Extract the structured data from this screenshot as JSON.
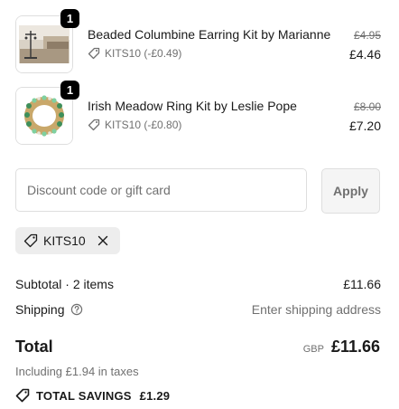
{
  "items": [
    {
      "quantity": "1",
      "name": "Beaded Columbine Earring Kit by Marianne",
      "discount": "KITS10 (-£0.49)",
      "original_price": "£4.95",
      "price": "£4.46",
      "thumbnail_icon": "earring-kit-photo"
    },
    {
      "quantity": "1",
      "name": "Irish Meadow Ring Kit by Leslie Pope",
      "discount": "KITS10 (-£0.80)",
      "original_price": "£8.00",
      "price": "£7.20",
      "thumbnail_icon": "ring-kit-photo"
    }
  ],
  "discount": {
    "placeholder": "Discount code or gift card",
    "value": "",
    "apply_label": "Apply",
    "applied_code": "KITS10"
  },
  "summary": {
    "subtotal_label": "Subtotal · 2 items",
    "subtotal_value": "£11.66",
    "shipping_label": "Shipping",
    "shipping_value": "Enter shipping address",
    "total_label": "Total",
    "currency": "GBP",
    "total_value": "£11.66",
    "taxes_text": "Including £1.94 in taxes",
    "savings_label": "TOTAL SAVINGS",
    "savings_value": "£1.29"
  },
  "colors": {
    "text": "#1a1a1a",
    "muted": "#707070",
    "border": "#dedede",
    "chip_bg": "#ededed",
    "badge_bg": "#000000"
  }
}
